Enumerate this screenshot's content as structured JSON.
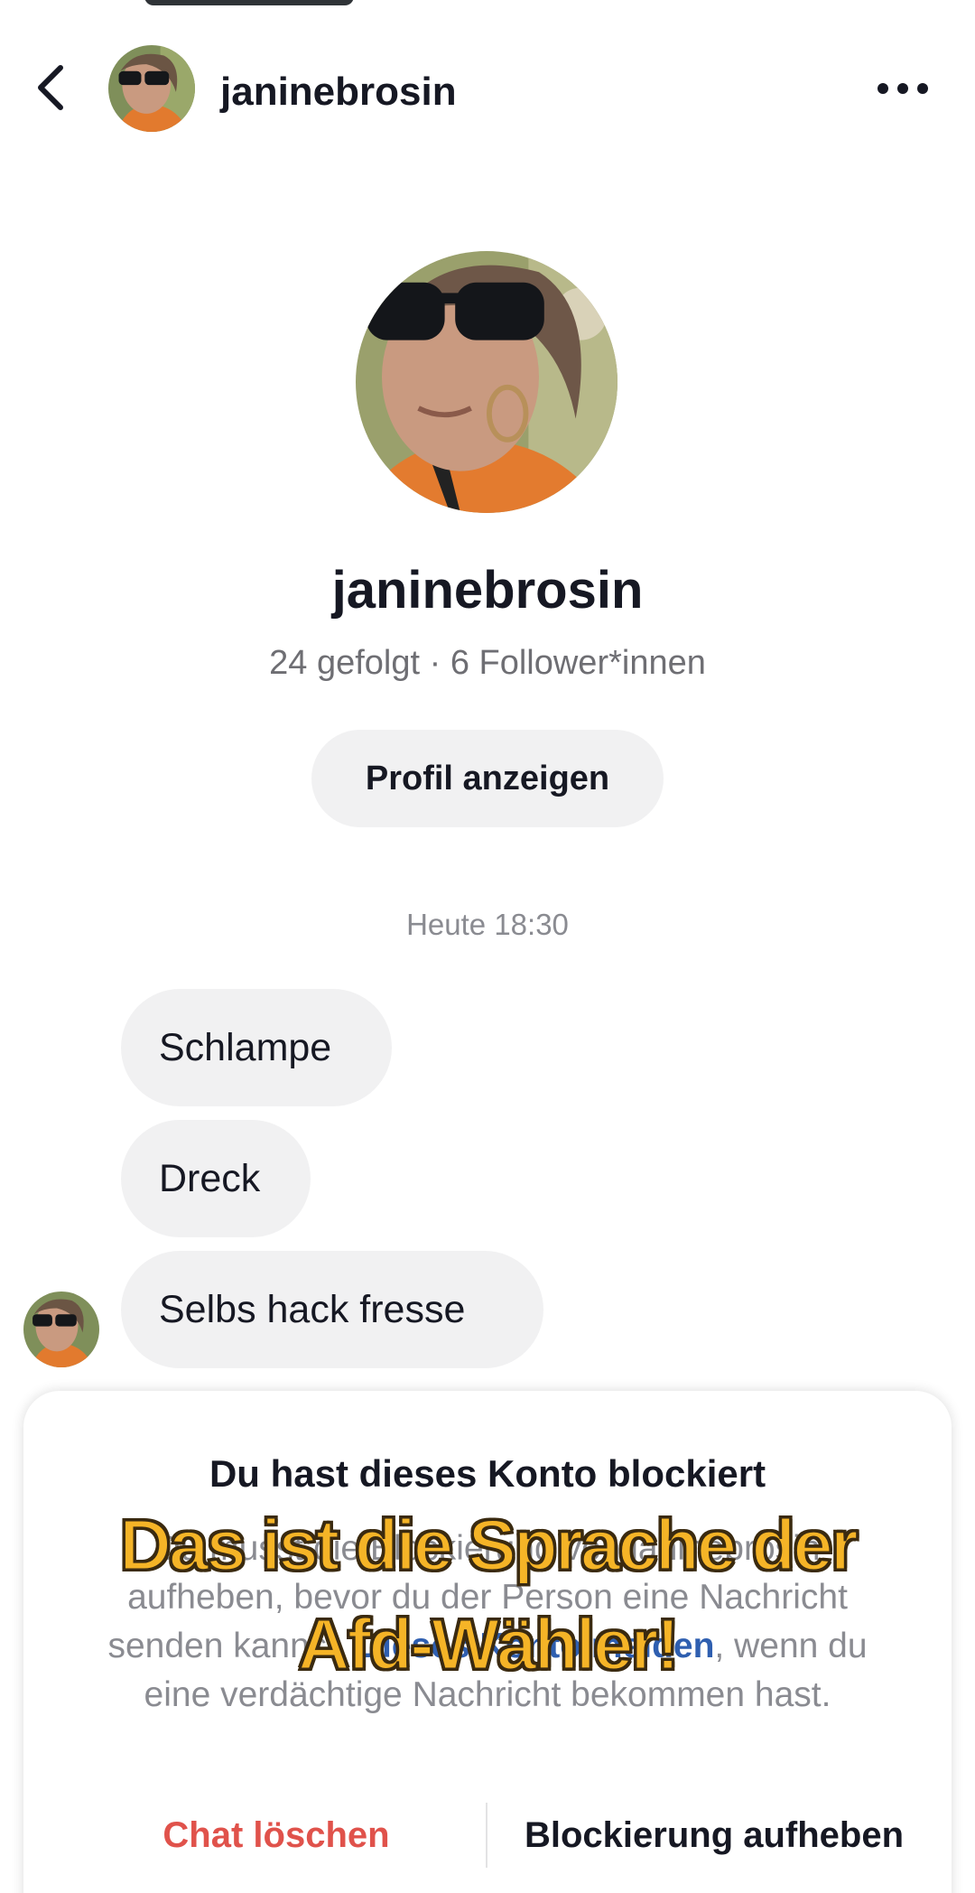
{
  "header": {
    "username": "janinebrosin",
    "back_icon": "chevron-left-icon",
    "more_icon": "more-horizontal-icon"
  },
  "profile": {
    "name": "janinebrosin",
    "stats": "24 gefolgt · 6 Follower*innen",
    "view_button": "Profil anzeigen"
  },
  "conversation": {
    "timestamp": "Heute 18:30",
    "messages": [
      {
        "text": "Schlampe"
      },
      {
        "text": "Dreck"
      },
      {
        "text": "Selbs hack fresse"
      }
    ]
  },
  "blocked_card": {
    "title": "Du hast dieses Konto blockiert",
    "body_part1": "Du musst die Blockierung von janinebrosin aufheben, bevor du der Person eine Nachricht senden kannst. ",
    "report_link": "Dieses Konto melden",
    "body_part2": ", wenn du eine verdächtige Nachricht bekommen hast.",
    "delete_chat": "Chat löschen",
    "unblock": "Blockierung aufheben"
  },
  "overlay_caption": {
    "line1": "Das ist die Sprache der",
    "line2": "Afd-Wähler!"
  },
  "colors": {
    "bubble": "#f1f1f2",
    "link": "#2f5fb0",
    "danger": "#e0524b",
    "caption": "#f5b427"
  }
}
